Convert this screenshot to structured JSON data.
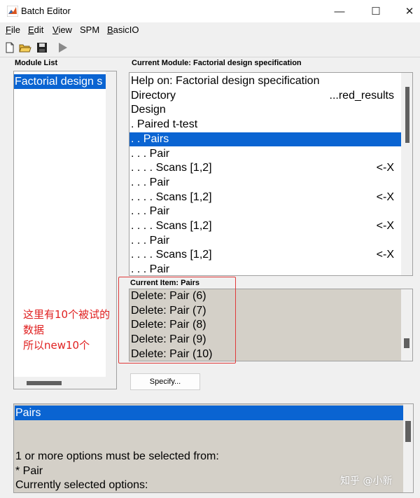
{
  "window": {
    "title": "Batch Editor",
    "minimize": "—",
    "maximize": "☐",
    "close": "✕"
  },
  "menu": [
    {
      "label": "File",
      "ul": "F",
      "rest": "ile"
    },
    {
      "label": "Edit",
      "ul": "E",
      "rest": "dit"
    },
    {
      "label": "View",
      "ul": "V",
      "rest": "iew"
    },
    {
      "label": "SPM",
      "ul": "",
      "rest": "SPM"
    },
    {
      "label": "BasicIO",
      "ul": "B",
      "rest": "asicIO"
    }
  ],
  "toolbar": {
    "icons": [
      "new-file-icon",
      "open-folder-icon",
      "save-icon",
      "run-icon"
    ]
  },
  "module_list": {
    "heading": "Module List",
    "items": [
      {
        "label": "Factorial design s",
        "selected": true
      }
    ]
  },
  "current_module": {
    "heading": "Current Module: Factorial design specification",
    "rows": [
      {
        "label": "Help on: Factorial design specification",
        "value": "",
        "selected": false
      },
      {
        "label": "Directory",
        "value": "...red_results",
        "selected": false
      },
      {
        "label": "Design",
        "value": "",
        "selected": false
      },
      {
        "label": ". Paired t-test",
        "value": "",
        "selected": false
      },
      {
        "label": ". . Pairs",
        "value": "",
        "selected": true
      },
      {
        "label": ". . . Pair",
        "value": "",
        "selected": false
      },
      {
        "label": ". . . . Scans [1,2]",
        "value": "<-X",
        "selected": false
      },
      {
        "label": ". . . Pair",
        "value": "",
        "selected": false
      },
      {
        "label": ". . . . Scans [1,2]",
        "value": "<-X",
        "selected": false
      },
      {
        "label": ". . . Pair",
        "value": "",
        "selected": false
      },
      {
        "label": ". . . . Scans [1,2]",
        "value": "<-X",
        "selected": false
      },
      {
        "label": ". . . Pair",
        "value": "",
        "selected": false
      },
      {
        "label": ". . . . Scans [1,2]",
        "value": "<-X",
        "selected": false
      },
      {
        "label": ". . . Pair",
        "value": "",
        "selected": false
      }
    ]
  },
  "current_item": {
    "heading": "Current Item: Pairs",
    "rows": [
      "Delete: Pair (6)",
      "Delete: Pair (7)",
      "Delete: Pair (8)",
      "Delete: Pair (9)",
      "Delete: Pair (10)"
    ]
  },
  "specify_button": "Specify...",
  "annotation": {
    "line1": "这里有10个被试的",
    "line2": "数据",
    "line3": "所以new10个"
  },
  "help_panel": {
    "title": "Pairs",
    "lines": [
      "1 or more options must be selected from:",
      "* Pair",
      "Currently selected options:"
    ]
  },
  "watermark": "知乎 @小新",
  "colors": {
    "selection": "#0a64d2",
    "annotation": "#e02020"
  }
}
